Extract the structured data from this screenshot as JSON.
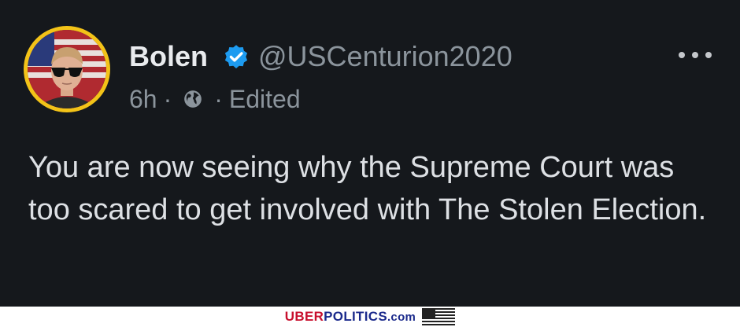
{
  "post": {
    "author_name": "Bolen",
    "handle": "@USCenturion2020",
    "time": "6h",
    "dot1": "·",
    "dot2": "·",
    "edited": "Edited",
    "text": "You are now seeing why the Supreme Court was too scared to get involved with The Stolen Election."
  },
  "icons": {
    "verified": "verified-check-icon",
    "globe": "globe-icon",
    "more": "more-options-icon"
  },
  "colors": {
    "background": "#15181c",
    "verified_blue": "#1d9bf0",
    "avatar_ring": "#f3c318",
    "primary_text": "#e9ebee",
    "secondary_text": "#8b949c"
  },
  "footer": {
    "brand_uber": "UBER",
    "brand_politics": "POLITICS",
    "brand_com": ".com"
  }
}
